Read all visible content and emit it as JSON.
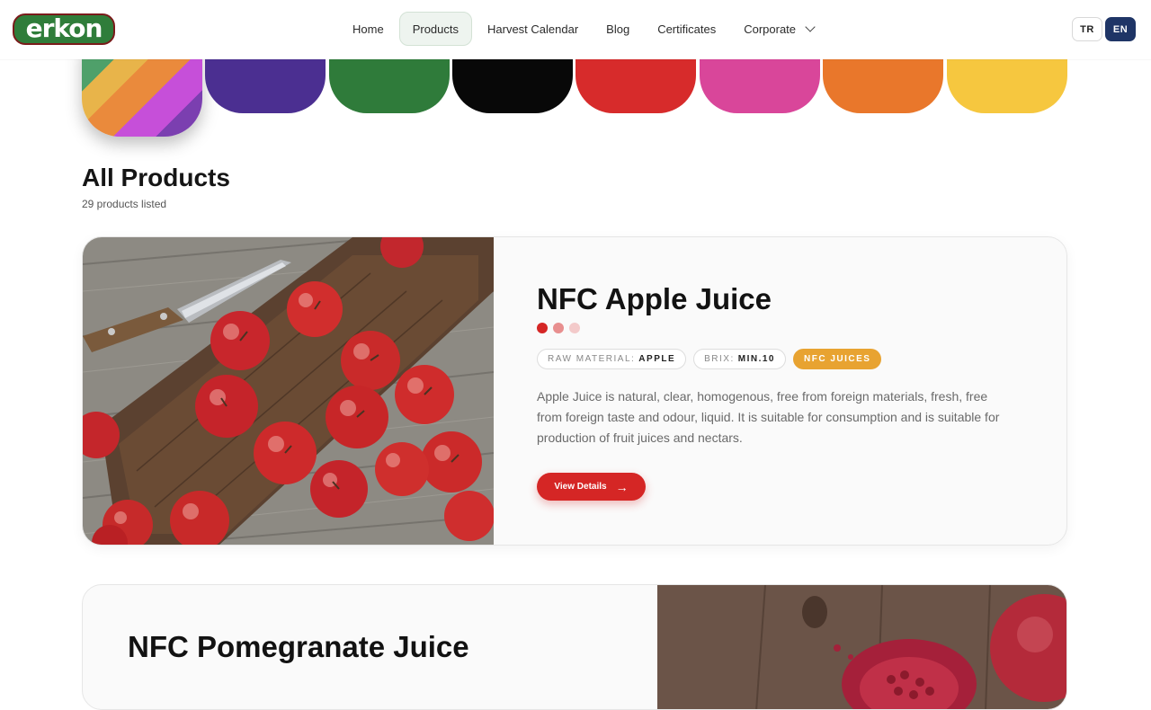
{
  "brand": {
    "logo_text": "erkon"
  },
  "nav": {
    "items": [
      {
        "label": "Home",
        "active": false
      },
      {
        "label": "Products",
        "active": true
      },
      {
        "label": "Harvest Calendar",
        "active": false
      },
      {
        "label": "Blog",
        "active": false
      },
      {
        "label": "Certificates",
        "active": false
      },
      {
        "label": "Corporate",
        "active": false,
        "has_dropdown": true
      }
    ],
    "languages": [
      {
        "label": "TR",
        "active": false
      },
      {
        "label": "EN",
        "active": true
      }
    ]
  },
  "categories": {
    "colors": [
      "#multi",
      "#4b2f91",
      "#2f7b3a",
      "#080808",
      "#d72b2b",
      "#d9469a",
      "#e9772b",
      "#f6c73f"
    ]
  },
  "page": {
    "title": "All Products",
    "count_text": "29 products listed"
  },
  "products": [
    {
      "title": "NFC Apple Juice",
      "indicator_colors": [
        "#d52625",
        "#e88f8f",
        "#f3caca"
      ],
      "raw_material_label": "RAW MATERIAL:",
      "raw_material_value": "APPLE",
      "brix_label": "BRIX:",
      "brix_value": "MIN.10",
      "category_tag": "NFC JUICES",
      "description": "Apple Juice is natural, clear, homogenous, free from foreign materials, fresh, free from foreign taste and odour, liquid. It is suitable for consumption and is suitable for production of fruit juices and nectars.",
      "button_label": "View Details",
      "image": "apples-on-cutting-board"
    },
    {
      "title": "NFC Pomegranate Juice",
      "image": "pomegranate-on-wood"
    }
  ],
  "colors": {
    "accent_red": "#d52625",
    "tag_orange": "#e8a331",
    "lang_active": "#1f3566",
    "brand_green": "#2f7d3a"
  }
}
